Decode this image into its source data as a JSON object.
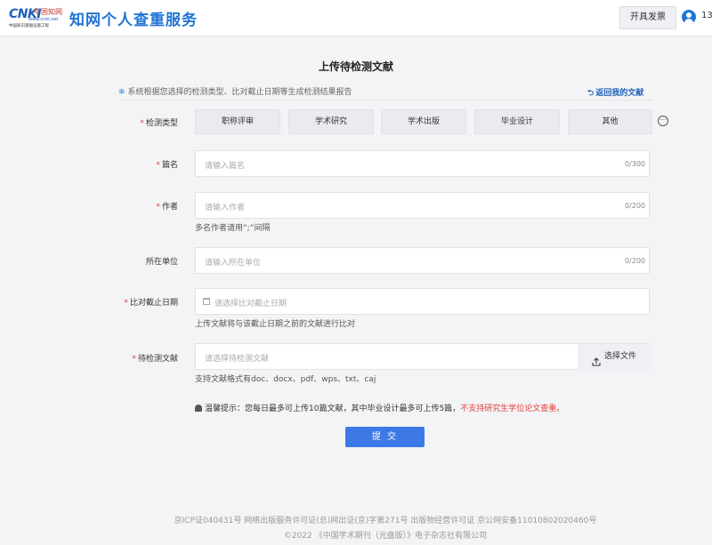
{
  "header": {
    "logo_main": "CNKI",
    "logo_cn": "中国知网",
    "logo_url": "www.cnki.net",
    "logo_sub": "中国知识基础设施工程",
    "site_title": "知网个人查重服务",
    "invoice_button": "开具发票",
    "user_short": "13"
  },
  "page": {
    "title": "上传待检测文献",
    "notice": "系统根据您选择的检测类型、比对截止日期等生成检测结果报告",
    "back_link": "返回我的文献"
  },
  "form": {
    "type_label": "检测类型",
    "types": [
      "职称评审",
      "学术研究",
      "学术出版",
      "毕业设计",
      "其他"
    ],
    "title_label": "篇名",
    "title_placeholder": "请输入篇名",
    "title_count": "0/300",
    "author_label": "作者",
    "author_placeholder": "请输入作者",
    "author_count": "0/200",
    "author_hint": "多名作者请用“;”间隔",
    "org_label": "所在单位",
    "org_placeholder": "请输入所在单位",
    "org_count": "0/200",
    "date_label": "比对截止日期",
    "date_placeholder": "请选择比对截止日期",
    "date_hint": "上传文献将与该截止日期之前的文献进行比对",
    "file_label": "待检测文献",
    "file_placeholder": "请选择待检测文献",
    "file_button": "选择文件",
    "file_hint": "支持文献格式有doc、docx、pdf、wps、txt、caj",
    "tip_prefix": "温馨提示：您每日最多可上传10篇文献，其中毕业设计最多可上传5篇，",
    "tip_warn": "不支持研究生学位论文查重。",
    "submit": "提 交"
  },
  "footer": {
    "line1": "京ICP证040431号  网络出版服务许可证(总)网出证(京)字第271号  出版物经营许可证  京公网安备11010802020460号",
    "line2": "©2022 《中国学术期刊（光盘版）》电子杂志社有限公司"
  },
  "colors": {
    "brand": "#1f74d6",
    "submit": "#3d79e6",
    "required": "#e53935"
  }
}
